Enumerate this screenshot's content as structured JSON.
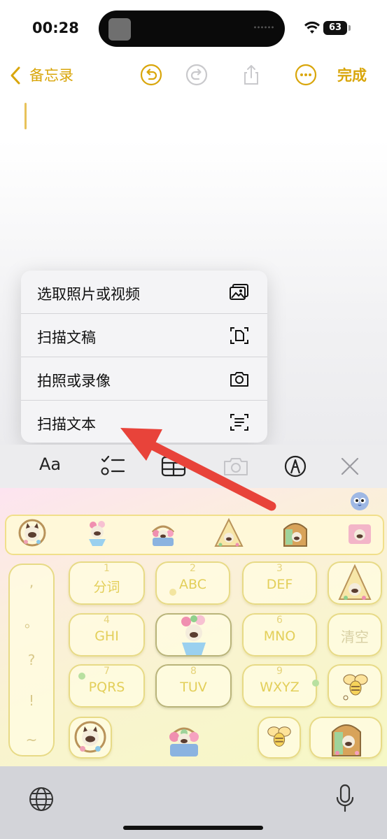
{
  "status": {
    "time": "00:28",
    "battery": "63"
  },
  "nav": {
    "back_label": "备忘录",
    "done_label": "完成"
  },
  "menu": {
    "items": [
      {
        "label": "选取照片或视频",
        "icon": "photo-library-icon"
      },
      {
        "label": "扫描文稿",
        "icon": "scan-document-icon"
      },
      {
        "label": "拍照或录像",
        "icon": "camera-icon"
      },
      {
        "label": "扫描文本",
        "icon": "scan-text-icon"
      }
    ]
  },
  "toolbar": {
    "format_label": "Aa"
  },
  "keyboard": {
    "keys": [
      {
        "num": "1",
        "label": "分词"
      },
      {
        "num": "2",
        "label": "ABC"
      },
      {
        "num": "3",
        "label": "DEF"
      },
      {
        "num": "4",
        "label": "GHI"
      },
      {
        "num": "6",
        "label": "MNO"
      },
      {
        "num": "7",
        "label": "PQRS"
      },
      {
        "num": "8",
        "label": "TUV"
      },
      {
        "num": "9",
        "label": "WXYZ"
      }
    ],
    "clear_label": "清空",
    "punctuation": [
      ",",
      "。",
      "?",
      "!",
      "~"
    ]
  },
  "colors": {
    "accent": "#d9a60b",
    "annotation_arrow": "#e8433a"
  }
}
